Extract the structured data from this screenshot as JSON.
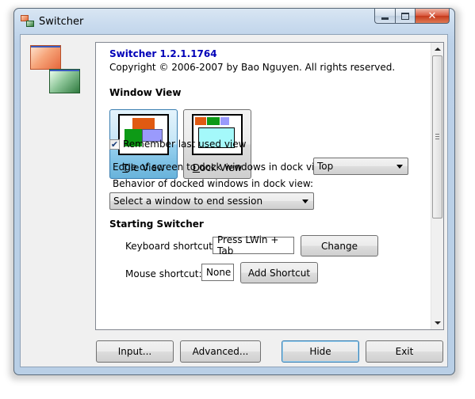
{
  "window": {
    "title": "Switcher"
  },
  "caption": {
    "minimize_icon": "minimize-icon",
    "maximize_icon": "maximize-icon",
    "close_icon": "close-icon"
  },
  "about": {
    "app_name": "Switcher 1.2.1.1764",
    "copyright": "Copyright © 2006-2007 by Bao Nguyen. All rights reserved."
  },
  "window_view": {
    "heading": "Window View",
    "tile": {
      "label_first": "T",
      "label_rest": "ile View",
      "selected": true
    },
    "dock": {
      "label_first": "D",
      "label_rest": "ock View",
      "selected": false
    },
    "remember": {
      "label": "Remember last used view",
      "checked": true
    },
    "edge_label": "Edge of screen to dock windows in dock view:",
    "edge_value": "Top",
    "behavior_label": "Behavior of docked windows in dock view:",
    "behavior_value": "Select a window to end session"
  },
  "starting": {
    "heading": "Starting Switcher",
    "keyboard_label": "Keyboard shortcut:",
    "keyboard_value": "Press LWin + Tab",
    "change_button": "Change",
    "mouse_label": "Mouse shortcut:",
    "mouse_value": "None",
    "add_shortcut_button": "Add Shortcut"
  },
  "footer": {
    "input_button": "Input...",
    "advanced_button": "Advanced...",
    "hide_button": "Hide",
    "exit_button": "Exit"
  },
  "colors": {
    "app_name": "#0000b8",
    "tile_orange": "#e05a12",
    "tile_green": "#0d9a16",
    "tile_purple": "#9a9afc",
    "dock_cyan": "#a4f9fa"
  }
}
